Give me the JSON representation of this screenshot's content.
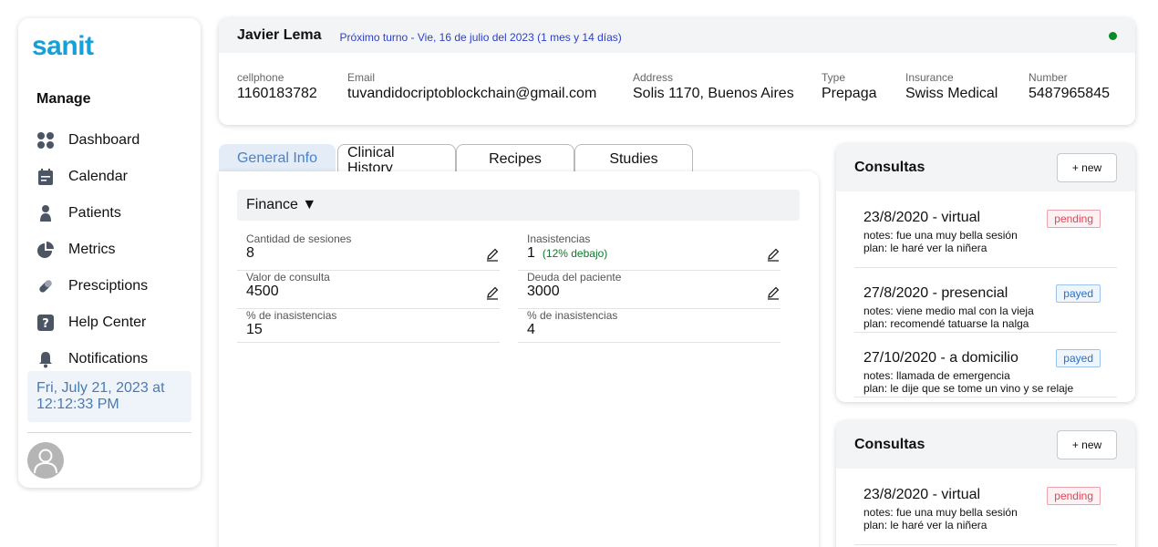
{
  "sidebar": {
    "logo": "sanit",
    "section_title": "Manage",
    "items": [
      {
        "label": "Dashboard",
        "icon": "dashboard-icon"
      },
      {
        "label": "Calendar",
        "icon": "calendar-icon"
      },
      {
        "label": "Patients",
        "icon": "user-icon"
      },
      {
        "label": "Metrics",
        "icon": "pie-chart-icon"
      },
      {
        "label": "Presciptions",
        "icon": "pill-icon"
      },
      {
        "label": "Help Center",
        "icon": "question-icon"
      },
      {
        "label": "Notifications",
        "icon": "bell-icon"
      }
    ],
    "datetime": "Fri, July 21, 2023 at 12:12:33 PM"
  },
  "patient": {
    "name": "Javier Lema",
    "next_appointment": "Próximo turno - Vie, 16 de julio del 2023 (1 mes y 14 días)",
    "status_color": "#0c8a2a",
    "fields": [
      {
        "label": "cellphone",
        "value": "1160183782"
      },
      {
        "label": "Email",
        "value": "tuvandidocriptoblockchain@gmail.com"
      },
      {
        "label": "Address",
        "value": "Solis 1170, Buenos Aires"
      },
      {
        "label": "Type",
        "value": "Prepaga"
      },
      {
        "label": "Insurance",
        "value": "Swiss Medical"
      },
      {
        "label": "Number",
        "value": "5487965845"
      }
    ]
  },
  "tabs": [
    {
      "label": "General Info",
      "active": true
    },
    {
      "label": "Clinical History",
      "active": false
    },
    {
      "label": "Recipes",
      "active": false
    },
    {
      "label": "Studies",
      "active": false
    }
  ],
  "finance": {
    "title": "Finance ▼",
    "fields": [
      {
        "label": "Cantidad de sesiones",
        "value": "8",
        "note": "",
        "editable": true
      },
      {
        "label": "Inasistencias",
        "value": "1",
        "note": "(12% debajo)",
        "editable": true
      },
      {
        "label": "Valor de consulta",
        "value": "4500",
        "note": "",
        "editable": true
      },
      {
        "label": "Deuda del paciente",
        "value": "3000",
        "note": "",
        "editable": true
      },
      {
        "label": "% de inasistencias",
        "value": "15",
        "note": "",
        "editable": false
      },
      {
        "label": "% de inasistencias",
        "value": "4",
        "note": "",
        "editable": false
      }
    ]
  },
  "consultas": [
    {
      "title": "Consultas",
      "new_label": "+ new",
      "items": [
        {
          "title": "23/8/2020 - virtual",
          "notes": "notes: fue una muy bella sesión",
          "plan": "plan: le haré ver la niñera",
          "status": "pending"
        },
        {
          "title": "27/8/2020 - presencial",
          "notes": "notes: viene medio mal con la vieja",
          "plan": "plan: recomendé tatuarse la nalga",
          "status": "payed"
        },
        {
          "title": "27/10/2020 - a domicilio",
          "notes": "notes: llamada de emergencia",
          "plan": "plan: le dije que se tome un vino y se relaje",
          "status": "payed"
        }
      ]
    },
    {
      "title": "Consultas",
      "new_label": "+ new",
      "items": [
        {
          "title": "23/8/2020 - virtual",
          "notes": "notes: fue una muy bella sesión",
          "plan": "plan: le haré ver la niñera",
          "status": "pending"
        }
      ]
    }
  ],
  "colors": {
    "brand": "#15a0d8",
    "accent_tab": "#4a82c4",
    "pending": "#e0455c",
    "payed": "#2a6fc4",
    "note_green": "#0b7a2b"
  }
}
